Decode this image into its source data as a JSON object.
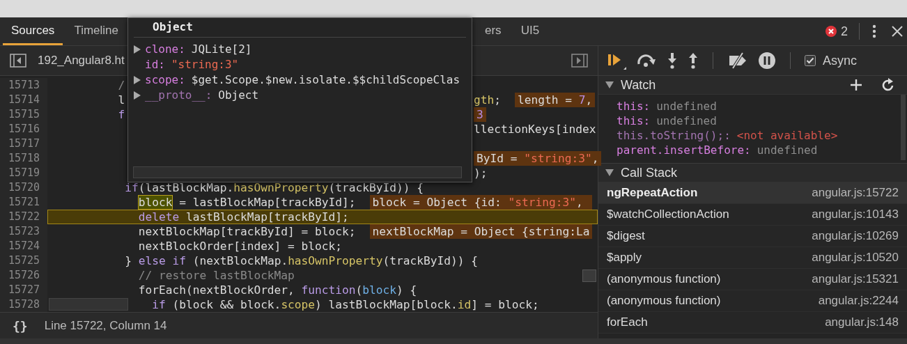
{
  "tabs": [
    {
      "label": "Sources",
      "selected": true
    },
    {
      "label": "Timeline",
      "selected": false
    },
    {
      "label": "ers",
      "selected": false
    },
    {
      "label": "UI5",
      "selected": false
    }
  ],
  "error_count": "2",
  "file_tab": "192_Angular8.ht",
  "code": {
    "lines": [
      {
        "number": "15713",
        "current": false,
        "left": [
          {
            "kind": "code",
            "tokens": [
              {
                "t": "          /",
                "kind": "comment"
              }
            ]
          }
        ]
      },
      {
        "number": "15714",
        "current": false,
        "left": [
          {
            "kind": "code",
            "tokens": [
              {
                "t": "          l",
                "kind": "plain"
              }
            ]
          }
        ],
        "right": [
          {
            "kind": "code",
            "tokens": [
              {
                "t": "gth",
                "kind": "method"
              },
              {
                "t": ";",
                "kind": "plain"
              }
            ]
          },
          {
            "kind": "annotation",
            "tokens": [
              {
                "t": "length = ",
                "kind": "plain"
              },
              {
                "t": "7",
                "kind": "number"
              },
              {
                "t": ",",
                "kind": "plain"
              }
            ]
          }
        ]
      },
      {
        "number": "15715",
        "current": false,
        "left": [
          {
            "kind": "code",
            "tokens": [
              {
                "t": "          f",
                "kind": "keyword"
              }
            ]
          }
        ],
        "right": [
          {
            "kind": "annotation",
            "tokens": [
              {
                "t": "3",
                "kind": "number"
              }
            ]
          }
        ]
      },
      {
        "number": "15716",
        "current": false,
        "right": [
          {
            "kind": "code",
            "tokens": [
              {
                "t": "llectionKeys[index",
                "kind": "plain"
              }
            ]
          }
        ]
      },
      {
        "number": "15717",
        "current": false
      },
      {
        "number": "15718",
        "current": false,
        "right": [
          {
            "kind": "annotation",
            "tokens": [
              {
                "t": "ById = ",
                "kind": "plain"
              },
              {
                "t": "\"string:3\"",
                "kind": "string"
              },
              {
                "t": ",",
                "kind": "plain"
              }
            ]
          }
        ]
      },
      {
        "number": "15719",
        "current": false,
        "right": [
          {
            "kind": "code",
            "tokens": [
              {
                "t": ");",
                "kind": "plain"
              }
            ]
          }
        ]
      },
      {
        "number": "15720",
        "current": false,
        "left": [
          {
            "kind": "code",
            "tokens": [
              {
                "t": "           if",
                "kind": "keyword"
              },
              {
                "t": "(lastBlockMap.",
                "kind": "plain"
              },
              {
                "t": "hasOwnProperty",
                "kind": "method"
              },
              {
                "t": "(trackById)) {",
                "kind": "plain"
              }
            ]
          }
        ]
      },
      {
        "number": "15721",
        "current": false,
        "left": [
          {
            "kind": "code",
            "tokens": [
              {
                "t": "             block",
                "kind": "match"
              },
              {
                "t": " = lastBlockMap[trackById];",
                "kind": "plain"
              }
            ]
          },
          {
            "kind": "annotation",
            "tokens": [
              {
                "t": "block = Object {id: ",
                "kind": "plain"
              },
              {
                "t": "\"string:3\"",
                "kind": "string"
              },
              {
                "t": ", ",
                "kind": "plain"
              }
            ]
          }
        ]
      },
      {
        "number": "15722",
        "current": true,
        "left": [
          {
            "kind": "code",
            "tokens": [
              {
                "t": "             delete",
                "kind": "keyword"
              },
              {
                "t": " lastBlockMap[trackById];",
                "kind": "plain"
              }
            ]
          }
        ]
      },
      {
        "number": "15723",
        "current": false,
        "left": [
          {
            "kind": "code",
            "tokens": [
              {
                "t": "             nextBlockMap[trackById] = block;",
                "kind": "plain"
              }
            ]
          },
          {
            "kind": "annotation",
            "tokens": [
              {
                "t": "nextBlockMap = Object {string:La",
                "kind": "plain"
              }
            ]
          }
        ]
      },
      {
        "number": "15724",
        "current": false,
        "left": [
          {
            "kind": "code",
            "tokens": [
              {
                "t": "             nextBlockOrder[index] = block;",
                "kind": "plain"
              }
            ]
          }
        ]
      },
      {
        "number": "15725",
        "current": false,
        "left": [
          {
            "kind": "code",
            "tokens": [
              {
                "t": "           } ",
                "kind": "plain"
              },
              {
                "t": "else if",
                "kind": "keyword"
              },
              {
                "t": " (nextBlockMap.",
                "kind": "plain"
              },
              {
                "t": "hasOwnProperty",
                "kind": "method"
              },
              {
                "t": "(trackById)) {",
                "kind": "plain"
              }
            ]
          }
        ]
      },
      {
        "number": "15726",
        "current": false,
        "left": [
          {
            "kind": "code",
            "tokens": [
              {
                "t": "             // restore lastBlockMap",
                "kind": "comment"
              }
            ]
          }
        ]
      },
      {
        "number": "15727",
        "current": false,
        "left": [
          {
            "kind": "code",
            "tokens": [
              {
                "t": "             forEach(nextBlockOrder, ",
                "kind": "plain"
              },
              {
                "t": "function",
                "kind": "keyword"
              },
              {
                "t": "(",
                "kind": "plain"
              },
              {
                "t": "block",
                "kind": "param"
              },
              {
                "t": ") {",
                "kind": "plain"
              }
            ]
          }
        ]
      },
      {
        "number": "15728",
        "current": false,
        "left": [
          {
            "kind": "code",
            "tokens": [
              {
                "t": "               if",
                "kind": "keyword"
              },
              {
                "t": " (block && block.",
                "kind": "plain"
              },
              {
                "t": "scope",
                "kind": "method"
              },
              {
                "t": ") lastBlockMap[block.",
                "kind": "plain"
              },
              {
                "t": "id",
                "kind": "method"
              },
              {
                "t": "] = block;",
                "kind": "plain"
              }
            ]
          }
        ]
      }
    ]
  },
  "popover": {
    "title": "Object",
    "properties": [
      {
        "name": "clone:",
        "value": "JQLite[2]",
        "expandable": true,
        "internal": false,
        "kind": "object"
      },
      {
        "name": "id:",
        "value": "\"string:3\"",
        "expandable": false,
        "internal": false,
        "kind": "string"
      },
      {
        "name": "scope:",
        "value": "$get.Scope.$new.isolate.$$childScopeClas",
        "expandable": true,
        "internal": false,
        "kind": "object"
      },
      {
        "name": "__proto__:",
        "value": "Object",
        "expandable": true,
        "internal": true,
        "kind": "object"
      }
    ]
  },
  "status_bar": {
    "format_icon": "{}",
    "position": "Line 15722, Column 14"
  },
  "debugger": {
    "async": {
      "label": "Async",
      "checked": true
    }
  },
  "watch": {
    "title": "Watch",
    "expanded": true,
    "items": [
      {
        "name": "this:",
        "value": "undefined",
        "kind": "value"
      },
      {
        "name": "this:",
        "value": "undefined",
        "kind": "value"
      },
      {
        "name": "this.toString();:",
        "value": "<not available>",
        "kind": "error"
      },
      {
        "name": "parent.insertBefore:",
        "value": "undefined",
        "kind": "value"
      }
    ]
  },
  "call_stack": {
    "title": "Call Stack",
    "expanded": true,
    "frames": [
      {
        "name": "ngRepeatAction",
        "location": "angular.js:15722",
        "selected": true
      },
      {
        "name": "$watchCollectionAction",
        "location": "angular.js:10143",
        "selected": false
      },
      {
        "name": "$digest",
        "location": "angular.js:10269",
        "selected": false
      },
      {
        "name": "$apply",
        "location": "angular.js:10520",
        "selected": false
      },
      {
        "name": "(anonymous function)",
        "location": "angular.js:15321",
        "selected": false
      },
      {
        "name": "(anonymous function)",
        "location": "angular.js:2244",
        "selected": false
      },
      {
        "name": "forEach",
        "location": "angular.js:148",
        "selected": false
      }
    ]
  }
}
